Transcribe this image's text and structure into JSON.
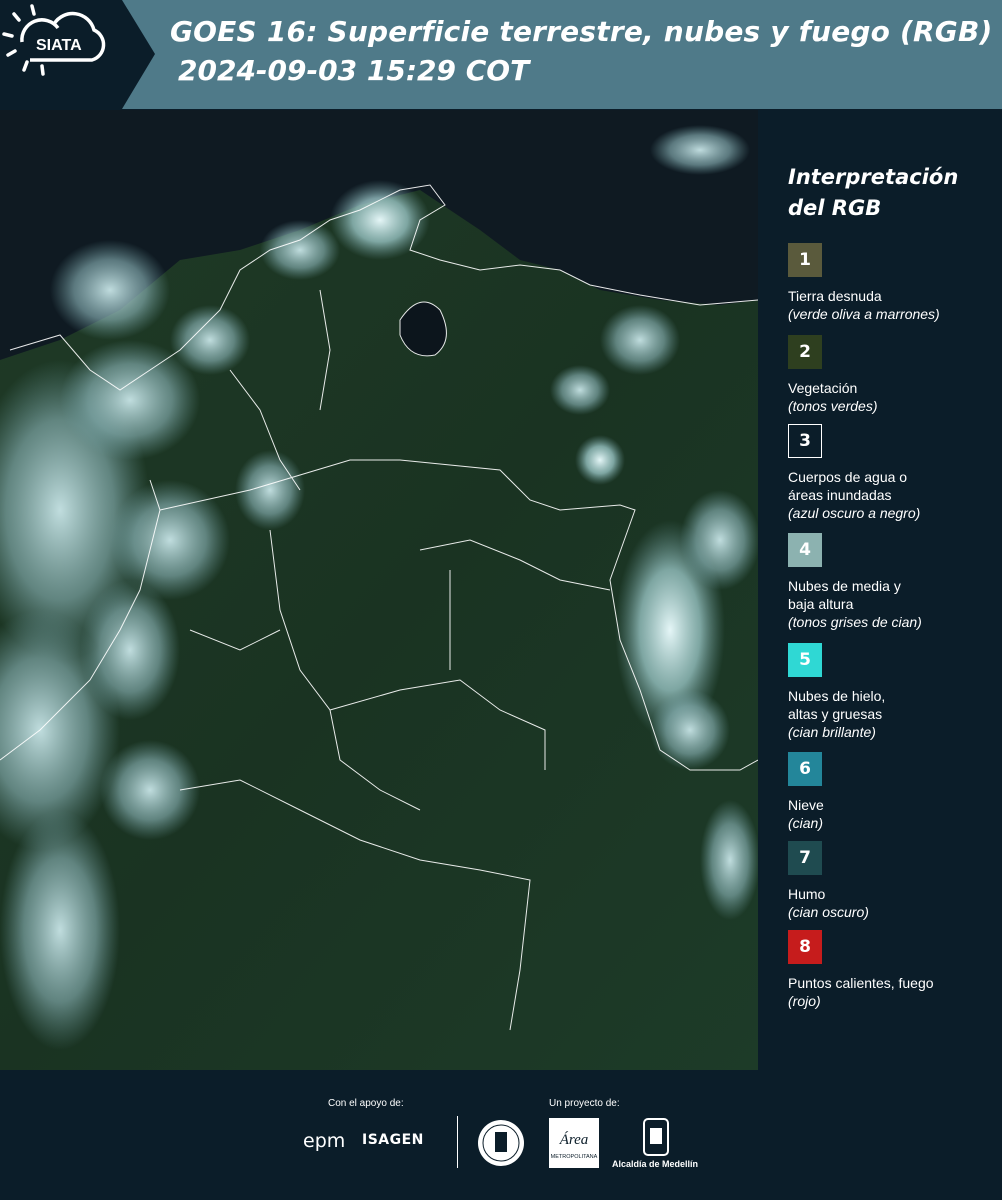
{
  "header": {
    "logo_text": "SIATA",
    "title": "GOES 16: Superficie terrestre, nubes y fuego (RGB)",
    "timestamp": "2024-09-03 15:29 COT",
    "colors": {
      "header_bg": "#4f7a89",
      "logo_bg": "#0b1d29"
    }
  },
  "legend": {
    "title_line1": "Interpretación",
    "title_line2": "del RGB",
    "items": [
      {
        "number": "1",
        "label": "Tierra desnuda",
        "sub": "(verde oliva a marrones)",
        "color": "#5a5a3c"
      },
      {
        "number": "2",
        "label": "Vegetación",
        "sub": "(tonos verdes)",
        "color": "#2e3f1f"
      },
      {
        "number": "3",
        "label": "Cuerpos de agua o",
        "label2": "áreas inundadas",
        "sub": "(azul oscuro a negro)",
        "color": "#0b1d29"
      },
      {
        "number": "4",
        "label": "Nubes de media y",
        "label2": "baja altura",
        "sub": "(tonos grises de cian)",
        "color": "#8cb2b0"
      },
      {
        "number": "5",
        "label": "Nubes de hielo,",
        "label2": "altas y gruesas",
        "sub": "(cian brillante)",
        "color": "#2fd8d4"
      },
      {
        "number": "6",
        "label": "Nieve",
        "sub": "(cian)",
        "color": "#23869a"
      },
      {
        "number": "7",
        "label": "Humo",
        "sub": "(cian oscuro)",
        "color": "#1f4b50"
      },
      {
        "number": "8",
        "label": "Puntos calientes, fuego",
        "sub": "(rojo)",
        "color": "#c61c1c"
      }
    ]
  },
  "footer": {
    "support_label": "Con el apoyo de:",
    "project_label": "Un proyecto de:",
    "epm": "epm",
    "isagen": "ISAGEN",
    "area_logo": "Área",
    "area_subtext": "METROPOLITANA",
    "medellin": "Alcaldía de Medellín"
  }
}
